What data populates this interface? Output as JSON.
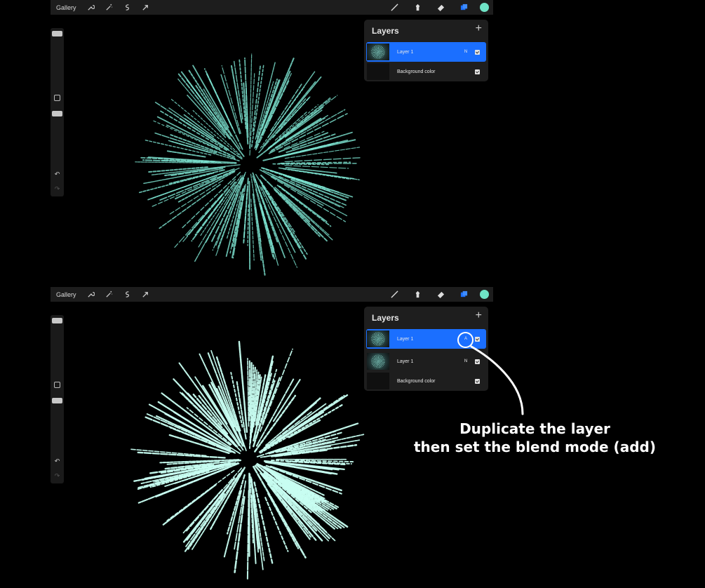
{
  "colors": {
    "accent": "#1b6fff",
    "brush_color": "#6fe3c6",
    "firework": "#7fe7d4"
  },
  "screens": [
    {
      "toolbar": {
        "gallery": "Gallery",
        "left_icons": [
          "wrench-icon",
          "magic-wand-icon",
          "selection-icon",
          "transform-arrow-icon"
        ],
        "right_icons": [
          "brush-icon",
          "smudge-icon",
          "eraser-icon",
          "layers-icon"
        ]
      },
      "layers_panel": {
        "title": "Layers",
        "add": "+",
        "rows": [
          {
            "name": "Layer 1",
            "blend": "N",
            "active": true
          },
          {
            "name": "Background color",
            "blend": ""
          }
        ]
      }
    },
    {
      "toolbar": {
        "gallery": "Gallery",
        "left_icons": [
          "wrench-icon",
          "magic-wand-icon",
          "selection-icon",
          "transform-arrow-icon"
        ],
        "right_icons": [
          "brush-icon",
          "smudge-icon",
          "eraser-icon",
          "layers-icon"
        ]
      },
      "layers_panel": {
        "title": "Layers",
        "add": "+",
        "rows": [
          {
            "name": "Layer 1",
            "blend": "A",
            "active": true
          },
          {
            "name": "Layer 1",
            "blend": "N"
          },
          {
            "name": "Background color",
            "blend": ""
          }
        ]
      }
    }
  ],
  "annotation": {
    "line1": "Duplicate the layer",
    "line2": "then set the blend mode (add)"
  }
}
